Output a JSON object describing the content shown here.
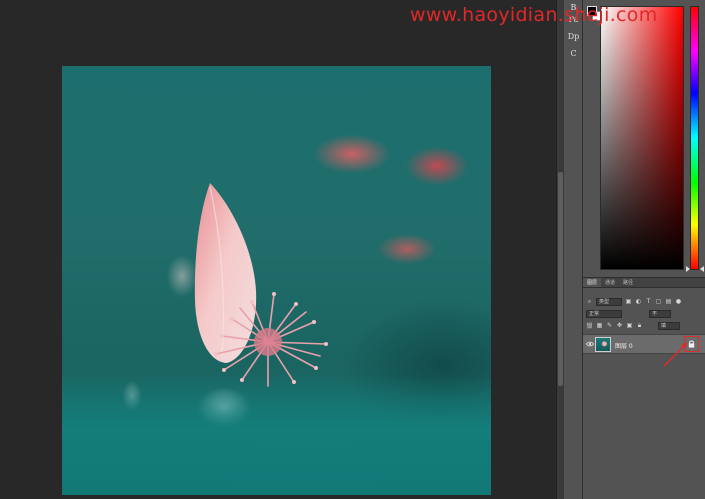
{
  "watermark": {
    "text": "www.haoyidian.sheji.com",
    "color": "#e12828"
  },
  "document": {
    "image": "lotus-petal-on-teal-background",
    "colors": {
      "teal": "#1d6f6f",
      "petal": "#f2b8b8",
      "stamen": "#e995a3"
    }
  },
  "toolstrip": {
    "items": [
      {
        "label": "B",
        "icon": "brush-preset-icon"
      },
      {
        "label": "Pa",
        "icon": "paragraph-icon"
      },
      {
        "label": "Dp",
        "icon": "device-preview-icon"
      },
      {
        "label": "C",
        "icon": "character-icon"
      }
    ]
  },
  "color_panel": {
    "foreground": "#000000",
    "background": "#ffffff",
    "hue": "#ff0000"
  },
  "layers_panel": {
    "tabs": [
      "图层",
      "通道",
      "路径"
    ],
    "active_tab": 0,
    "filter_kind": "类型",
    "blend_mode": "正常",
    "opacity_label": "不",
    "lock_label": "锁",
    "fill_label": "填",
    "layer": {
      "name": "图层 0",
      "visible": true,
      "locked": true
    }
  },
  "annotation": {
    "color": "#e32a2a"
  }
}
